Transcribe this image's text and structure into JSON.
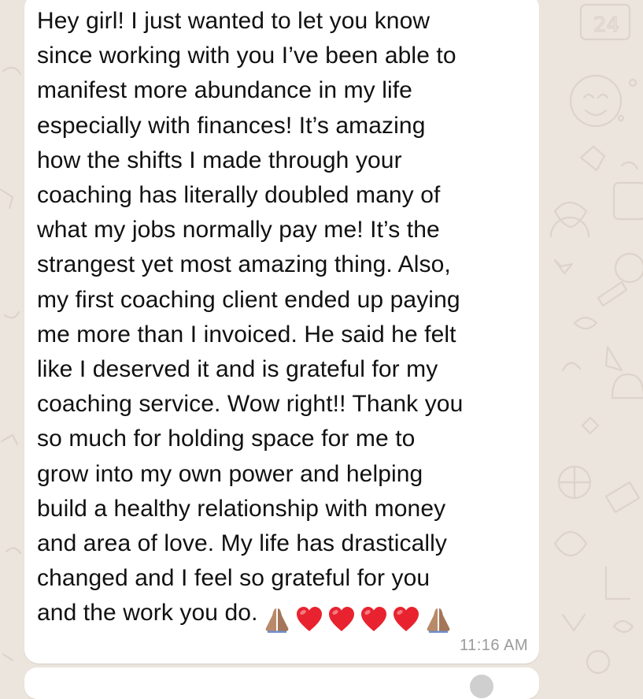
{
  "chat": {
    "message": {
      "lines": [
        "Hey girl! I just wanted to let you know",
        "since working with you I’ve been able to",
        "manifest more abundance in my life",
        "especially with finances! It’s amazing",
        "how the shifts I made through your",
        "coaching has literally doubled many of",
        "what my jobs normally pay me! It’s the",
        "strangest yet most amazing thing. Also,",
        "my first coaching client ended up paying",
        "me more than I invoiced. He said he felt",
        "like I deserved it and is grateful for my",
        "coaching service. Wow right!! Thank you",
        "so much for holding space for me to",
        "grow into my own power and helping",
        "build a healthy relationship with money",
        "and area of love. My life has drastically",
        "changed and I feel so grateful for you",
        "and the work you do."
      ],
      "emojis": [
        "folded-hands",
        "red-heart",
        "red-heart",
        "red-heart",
        "red-heart",
        "folded-hands"
      ],
      "timestamp": "11:16 AM"
    }
  },
  "colors": {
    "wallpaper": "#ECE5DD",
    "bubble": "#FFFFFF",
    "text": "#111111",
    "timestamp": "#9A9A9A",
    "heart": "#E8232F",
    "hands": "#B98A6A"
  }
}
